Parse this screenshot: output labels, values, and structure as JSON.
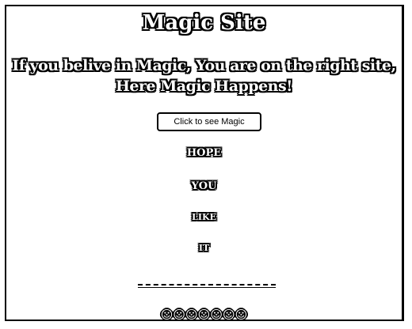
{
  "site": {
    "title": "Magic Site",
    "tagline_line1": "If you belive in Magic, You are on the right site,",
    "tagline_line2": "Here Magic Happens!"
  },
  "button": {
    "label": "Click to see Magic"
  },
  "words": {
    "w1": "HOPE",
    "w2": "YOU",
    "w3": "LIKE",
    "w4": "IT"
  },
  "footer": {
    "symbols": "☺☺☺☺☺☺☺"
  }
}
